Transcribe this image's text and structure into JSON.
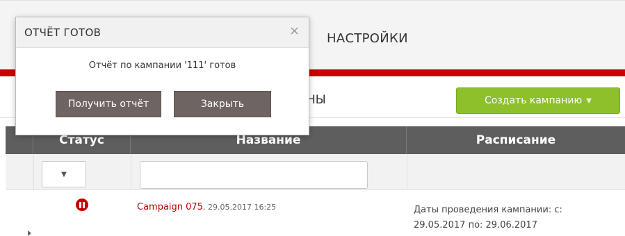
{
  "header": {
    "nav_settings": "НАСТРОЙКИ"
  },
  "toolbar": {
    "tab_partial": "НЫ",
    "create_campaign": "Создать кампанию",
    "create_caret": "▼"
  },
  "table": {
    "headers": {
      "status": "Статус",
      "name": "Название",
      "schedule": "Расписание"
    },
    "filter_select_arrow": "▼",
    "rows": [
      {
        "name": "Campaign 075",
        "date": ", 29.05.2017 16:25",
        "schedule_line1": "Даты проведения кампании: с:",
        "schedule_line2": "29.05.2017 по: 29.06.2017"
      }
    ]
  },
  "modal": {
    "title": "ОТЧЁТ ГОТОВ",
    "close_glyph": "×",
    "message": "Отчёт по кампании '111' готов",
    "get_report_button": "Получить отчёт",
    "close_button": "Закрыть"
  },
  "colors": {
    "accent_red": "#cc0000",
    "create_green": "#8dc02a",
    "header_gray": "#5e5e5e",
    "modal_button": "#6e6461"
  }
}
